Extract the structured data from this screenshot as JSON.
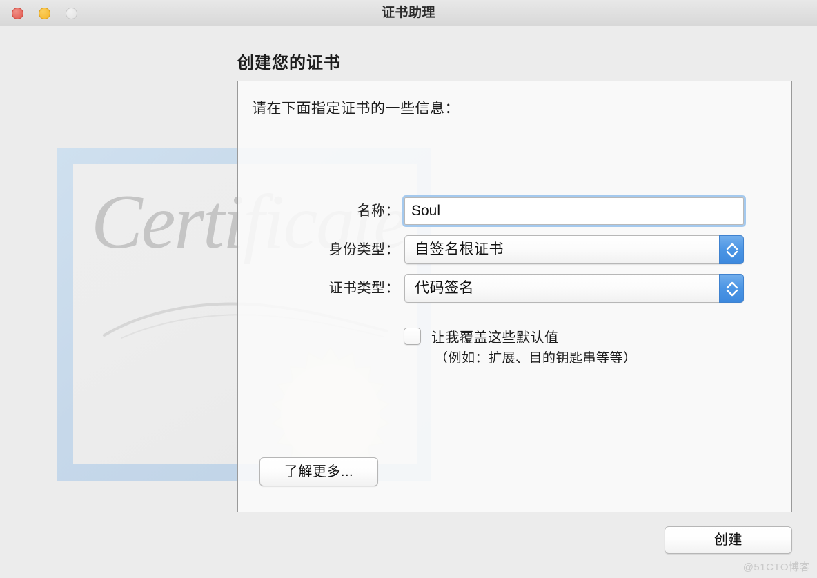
{
  "window": {
    "title": "证书助理",
    "traffic_lights": {
      "close": "close-button",
      "minimize": "minimize-button",
      "zoom": "zoom-button"
    }
  },
  "page": {
    "heading": "创建您的证书",
    "subtitle": "请在下面指定证书的一些信息："
  },
  "artwork": {
    "script_text": "Certificate"
  },
  "form": {
    "name": {
      "label": "名称：",
      "value": "Soul",
      "placeholder": ""
    },
    "identity_type": {
      "label": "身份类型：",
      "value": "自签名根证书"
    },
    "certificate_type": {
      "label": "证书类型：",
      "value": "代码签名"
    },
    "override": {
      "label": "让我覆盖这些默认值",
      "hint": "（例如：扩展、目的钥匙串等等）",
      "checked": false
    }
  },
  "buttons": {
    "learn_more": "了解更多...",
    "create": "创建"
  },
  "watermark": "@51CTO博客",
  "colors": {
    "window_bg": "#ececec",
    "titlebar_bg": "#e0e0e0",
    "accent_blue": "#4b95e4",
    "focus_ring": "#a4c9ee",
    "close_red": "#e0564c",
    "minimize_yellow": "#f5b429",
    "zoom_gray": "#e2e2e2"
  }
}
